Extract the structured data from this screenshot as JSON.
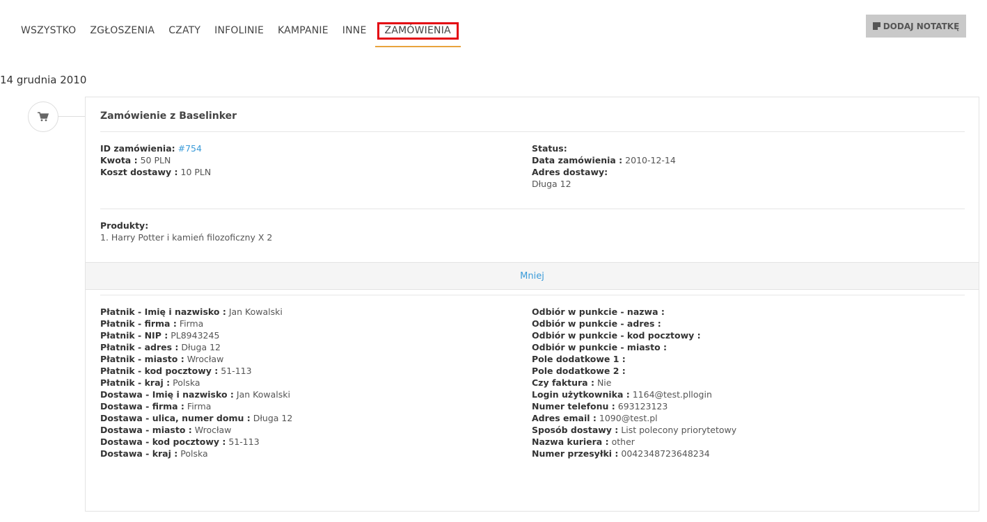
{
  "tabs": [
    {
      "label": "WSZYSTKO"
    },
    {
      "label": "ZGŁOSZENIA"
    },
    {
      "label": "CZATY"
    },
    {
      "label": "INFOLINIE"
    },
    {
      "label": "KAMPANIE"
    },
    {
      "label": "INNE"
    },
    {
      "label": "ZAMÓWIENIA",
      "active": true
    }
  ],
  "note_button": {
    "label": "DODAJ NOTATKĘ",
    "icon": "note-icon"
  },
  "date": "14 grudnia 2010",
  "timeline": {
    "icon": "cart-icon"
  },
  "order": {
    "title": "Zamówienie z Baselinker",
    "id_label": "ID zamówienia:",
    "id_value": "#754",
    "amount_label": "Kwota :",
    "amount_value": "50 PLN",
    "shipping_cost_label": "Koszt dostawy :",
    "shipping_cost_value": "10 PLN",
    "status_label": "Status:",
    "status_value": "",
    "order_date_label": "Data zamówienia :",
    "order_date_value": "2010-12-14",
    "address_label": "Adres dostawy:",
    "address_value": "Długa 12",
    "products_label": "Produkty:",
    "products_value": "1. Harry Potter i kamień filozoficzny X 2",
    "toggle_label": "Mniej",
    "details_left": [
      {
        "label": "Płatnik - Imię i nazwisko :",
        "value": "Jan Kowalski"
      },
      {
        "label": "Płatnik - firma :",
        "value": "Firma"
      },
      {
        "label": "Płatnik - NIP :",
        "value": "PL8943245"
      },
      {
        "label": "Płatnik - adres :",
        "value": "Długa 12"
      },
      {
        "label": "Płatnik - miasto :",
        "value": "Wrocław"
      },
      {
        "label": "Płatnik - kod pocztowy :",
        "value": "51-113"
      },
      {
        "label": "Płatnik - kraj :",
        "value": "Polska"
      },
      {
        "label": "Dostawa - Imię i nazwisko :",
        "value": "Jan Kowalski"
      },
      {
        "label": "Dostawa - firma :",
        "value": "Firma"
      },
      {
        "label": "Dostawa - ulica, numer domu :",
        "value": "Długa 12"
      },
      {
        "label": "Dostawa - miasto :",
        "value": "Wrocław"
      },
      {
        "label": "Dostawa - kod pocztowy :",
        "value": "51-113"
      },
      {
        "label": "Dostawa - kraj :",
        "value": "Polska"
      }
    ],
    "details_right": [
      {
        "label": "Odbiór w punkcie - nazwa :",
        "value": ""
      },
      {
        "label": "Odbiór w punkcie - adres :",
        "value": ""
      },
      {
        "label": "Odbiór w punkcie - kod pocztowy :",
        "value": ""
      },
      {
        "label": "Odbiór w punkcie - miasto :",
        "value": ""
      },
      {
        "label": "Pole dodatkowe 1 :",
        "value": ""
      },
      {
        "label": "Pole dodatkowe 2 :",
        "value": ""
      },
      {
        "label": "Czy faktura :",
        "value": "Nie"
      },
      {
        "label": "Login użytkownika :",
        "value": "1164@test.pllogin"
      },
      {
        "label": "Numer telefonu :",
        "value": "693123123"
      },
      {
        "label": "Adres email :",
        "value": "1090@test.pl"
      },
      {
        "label": "Sposób dostawy :",
        "value": "List polecony priorytetowy"
      },
      {
        "label": "Nazwa kuriera :",
        "value": "other"
      },
      {
        "label": "Numer przesyłki :",
        "value": "0042348723648234"
      }
    ]
  },
  "colors": {
    "accent_underline": "#e8a33d",
    "highlight_box": "#e30613",
    "link": "#3a9bd9",
    "button_bg": "#c9c9c9"
  }
}
